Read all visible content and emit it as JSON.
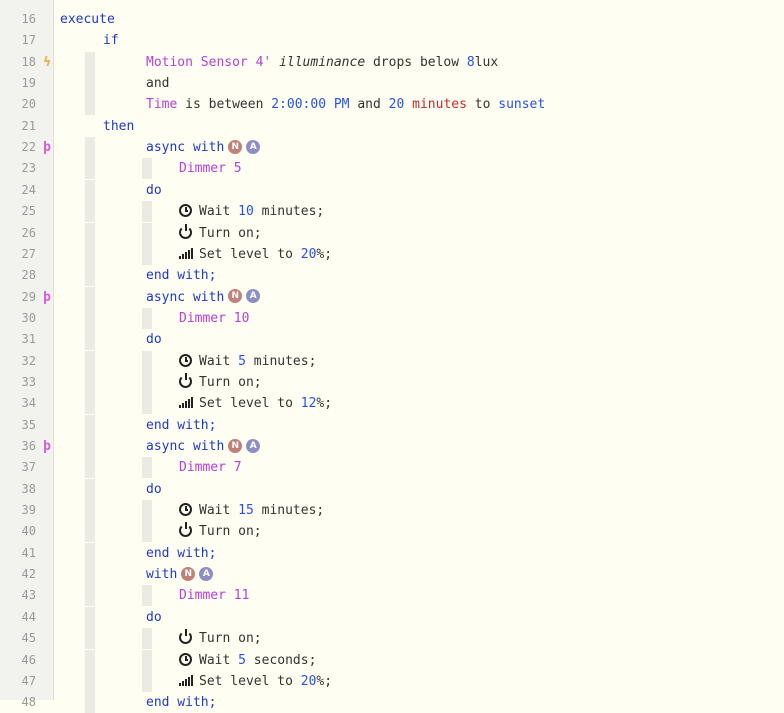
{
  "colors": {
    "background": "#fffef2",
    "gutter": "#f2f2ef",
    "keyword": "#1f39c8",
    "device": "#b640d9",
    "number": "#2552e5",
    "unit": "#c42c2c",
    "text": "#333333",
    "bolt_icon": "#f0ad4e",
    "parallel_icon": "#d45cd6",
    "badge_n": "#c0817b",
    "badge_a": "#8d8fc4"
  },
  "lines": [
    {
      "n": "16",
      "indent": 0,
      "tokens": [
        {
          "t": "kw",
          "v": "execute"
        }
      ]
    },
    {
      "n": "17",
      "indent": 1,
      "tokens": [
        {
          "t": "kw",
          "v": "if"
        }
      ]
    },
    {
      "n": "18",
      "indent": 2,
      "marker": "bolt-icon",
      "tokens": [
        {
          "t": "dev",
          "v": "Motion Sensor 4'"
        },
        {
          "t": "text",
          "v": " "
        },
        {
          "t": "attr",
          "v": "illuminance"
        },
        {
          "t": "text",
          "v": " drops below "
        },
        {
          "t": "num",
          "v": "8"
        },
        {
          "t": "text",
          "v": "lux"
        }
      ]
    },
    {
      "n": "19",
      "indent": 2,
      "tokens": [
        {
          "t": "text",
          "v": "and"
        }
      ]
    },
    {
      "n": "20",
      "indent": 2,
      "tokens": [
        {
          "t": "var",
          "v": "Time"
        },
        {
          "t": "text",
          "v": " is between "
        },
        {
          "t": "num",
          "v": "2:00:00 PM"
        },
        {
          "t": "text",
          "v": " and "
        },
        {
          "t": "num",
          "v": "20"
        },
        {
          "t": "text",
          "v": " "
        },
        {
          "t": "unit",
          "v": "minutes"
        },
        {
          "t": "text",
          "v": " to "
        },
        {
          "t": "num",
          "v": "sunset"
        }
      ]
    },
    {
      "n": "21",
      "indent": 1,
      "tokens": [
        {
          "t": "kw",
          "v": "then"
        }
      ]
    },
    {
      "n": "22",
      "indent": 2,
      "marker": "parallel-icon",
      "tokens": [
        {
          "t": "kw",
          "v": "async with"
        }
      ],
      "badges": [
        "N",
        "A"
      ]
    },
    {
      "n": "23",
      "indent": 3,
      "tokens": [
        {
          "t": "dev",
          "v": "Dimmer 5"
        }
      ]
    },
    {
      "n": "24",
      "indent": 2,
      "tokens": [
        {
          "t": "kw",
          "v": "do"
        }
      ]
    },
    {
      "n": "25",
      "indent": 3,
      "icon": "clock-icon",
      "tokens": [
        {
          "t": "text",
          "v": "Wait "
        },
        {
          "t": "num",
          "v": "10"
        },
        {
          "t": "text",
          "v": " minutes;"
        }
      ]
    },
    {
      "n": "26",
      "indent": 3,
      "icon": "power-icon",
      "tokens": [
        {
          "t": "text",
          "v": "Turn on;"
        }
      ]
    },
    {
      "n": "27",
      "indent": 3,
      "icon": "signal-level-icon",
      "tokens": [
        {
          "t": "text",
          "v": "Set level to "
        },
        {
          "t": "num",
          "v": "20"
        },
        {
          "t": "text",
          "v": "%;"
        }
      ]
    },
    {
      "n": "28",
      "indent": 2,
      "tokens": [
        {
          "t": "kw",
          "v": "end with;"
        }
      ]
    },
    {
      "n": "29",
      "indent": 2,
      "marker": "parallel-icon",
      "tokens": [
        {
          "t": "kw",
          "v": "async with"
        }
      ],
      "badges": [
        "N",
        "A"
      ]
    },
    {
      "n": "30",
      "indent": 3,
      "tokens": [
        {
          "t": "dev",
          "v": "Dimmer 10"
        }
      ]
    },
    {
      "n": "31",
      "indent": 2,
      "tokens": [
        {
          "t": "kw",
          "v": "do"
        }
      ]
    },
    {
      "n": "32",
      "indent": 3,
      "icon": "clock-icon",
      "tokens": [
        {
          "t": "text",
          "v": "Wait "
        },
        {
          "t": "num",
          "v": "5"
        },
        {
          "t": "text",
          "v": " minutes;"
        }
      ]
    },
    {
      "n": "33",
      "indent": 3,
      "icon": "power-icon",
      "tokens": [
        {
          "t": "text",
          "v": "Turn on;"
        }
      ]
    },
    {
      "n": "34",
      "indent": 3,
      "icon": "signal-level-icon",
      "tokens": [
        {
          "t": "text",
          "v": "Set level to "
        },
        {
          "t": "num",
          "v": "12"
        },
        {
          "t": "text",
          "v": "%;"
        }
      ]
    },
    {
      "n": "35",
      "indent": 2,
      "tokens": [
        {
          "t": "kw",
          "v": "end with;"
        }
      ]
    },
    {
      "n": "36",
      "indent": 2,
      "marker": "parallel-icon",
      "tokens": [
        {
          "t": "kw",
          "v": "async with"
        }
      ],
      "badges": [
        "N",
        "A"
      ]
    },
    {
      "n": "37",
      "indent": 3,
      "tokens": [
        {
          "t": "dev",
          "v": "Dimmer 7"
        }
      ]
    },
    {
      "n": "38",
      "indent": 2,
      "tokens": [
        {
          "t": "kw",
          "v": "do"
        }
      ]
    },
    {
      "n": "39",
      "indent": 3,
      "icon": "clock-icon",
      "tokens": [
        {
          "t": "text",
          "v": "Wait "
        },
        {
          "t": "num",
          "v": "15"
        },
        {
          "t": "text",
          "v": " minutes;"
        }
      ]
    },
    {
      "n": "40",
      "indent": 3,
      "icon": "power-icon",
      "tokens": [
        {
          "t": "text",
          "v": "Turn on;"
        }
      ]
    },
    {
      "n": "41",
      "indent": 2,
      "tokens": [
        {
          "t": "kw",
          "v": "end with;"
        }
      ]
    },
    {
      "n": "42",
      "indent": 2,
      "tokens": [
        {
          "t": "kw",
          "v": "with"
        }
      ],
      "badges": [
        "N",
        "A"
      ]
    },
    {
      "n": "43",
      "indent": 3,
      "tokens": [
        {
          "t": "dev",
          "v": "Dimmer 11"
        }
      ]
    },
    {
      "n": "44",
      "indent": 2,
      "tokens": [
        {
          "t": "kw",
          "v": "do"
        }
      ]
    },
    {
      "n": "45",
      "indent": 3,
      "icon": "power-icon",
      "tokens": [
        {
          "t": "text",
          "v": "Turn on;"
        }
      ]
    },
    {
      "n": "46",
      "indent": 3,
      "icon": "clock-icon",
      "tokens": [
        {
          "t": "text",
          "v": "Wait "
        },
        {
          "t": "num",
          "v": "5"
        },
        {
          "t": "text",
          "v": " seconds;"
        }
      ]
    },
    {
      "n": "47",
      "indent": 3,
      "icon": "signal-level-icon",
      "tokens": [
        {
          "t": "text",
          "v": "Set level to "
        },
        {
          "t": "num",
          "v": "20"
        },
        {
          "t": "text",
          "v": "%;"
        }
      ]
    },
    {
      "n": "48",
      "indent": 2,
      "tokens": [
        {
          "t": "kw",
          "v": "end with;"
        }
      ]
    }
  ]
}
